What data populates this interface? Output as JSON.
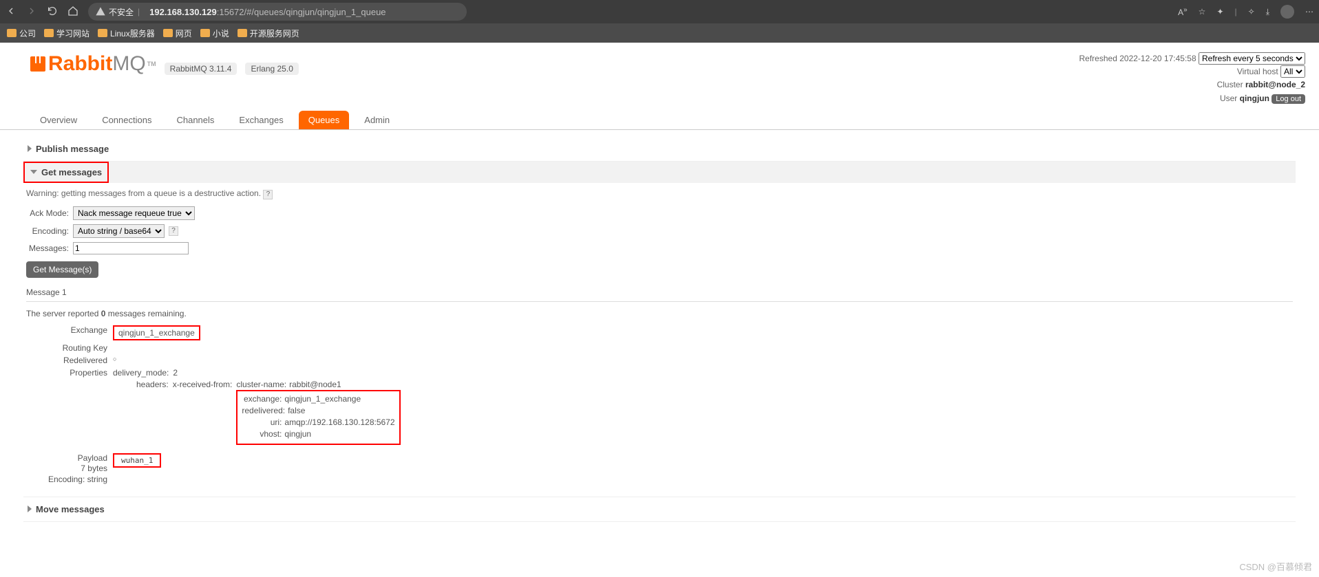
{
  "browser": {
    "insecure_label": "不安全",
    "url_host": "192.168.130.129",
    "url_port_path": ":15672/#/queues/qingjun/qingjun_1_queue"
  },
  "bookmarks": [
    "公司",
    "学习网站",
    "Linux服务器",
    "网页",
    "小说",
    "开源服务网页"
  ],
  "logo": {
    "rabbit": "Rabbit",
    "mq": "MQ",
    "tm": "TM"
  },
  "versions": {
    "rmq": "RabbitMQ 3.11.4",
    "erlang": "Erlang 25.0"
  },
  "header_right": {
    "refreshed_label": "Refreshed",
    "refreshed_time": "2022-12-20 17:45:58",
    "refresh_select": "Refresh every 5 seconds",
    "vhost_label": "Virtual host",
    "vhost_value": "All",
    "cluster_label": "Cluster",
    "cluster_value": "rabbit@node_2",
    "user_label": "User",
    "user_value": "qingjun",
    "logout": "Log out"
  },
  "tabs": [
    "Overview",
    "Connections",
    "Channels",
    "Exchanges",
    "Queues",
    "Admin"
  ],
  "active_tab": "Queues",
  "sections": {
    "publish": "Publish message",
    "get": "Get messages",
    "move": "Move messages"
  },
  "get_messages": {
    "warning": "Warning: getting messages from a queue is a destructive action.",
    "ack_label": "Ack Mode:",
    "ack_value": "Nack message requeue true",
    "enc_label": "Encoding:",
    "enc_value": "Auto string / base64",
    "msgs_label": "Messages:",
    "msgs_value": "1",
    "button": "Get Message(s)",
    "msg_header": "Message 1",
    "remaining_pre": "The server reported ",
    "remaining_count": "0",
    "remaining_post": " messages remaining."
  },
  "message": {
    "exchange_label": "Exchange",
    "exchange_value": "qingjun_1_exchange",
    "routing_label": "Routing Key",
    "routing_value": "",
    "redelivered_label": "Redelivered",
    "redelivered_value": "○",
    "properties_label": "Properties",
    "delivery_mode_label": "delivery_mode:",
    "delivery_mode_value": "2",
    "headers_label": "headers:",
    "xrecv_label": "x-received-from:",
    "cluster_name_label": "cluster-name:",
    "cluster_name_value": "rabbit@node1",
    "h_exchange_label": "exchange:",
    "h_exchange_value": "qingjun_1_exchange",
    "h_redelivered_label": "redelivered:",
    "h_redelivered_value": "false",
    "h_uri_label": "uri:",
    "h_uri_value": "amqp://192.168.130.128:5672",
    "h_vhost_label": "vhost:",
    "h_vhost_value": "qingjun",
    "payload_label": "Payload",
    "payload_size": "7 bytes",
    "payload_enc": "Encoding: string",
    "payload_value": "wuhan_1"
  },
  "watermark": "CSDN @百慕倾君"
}
